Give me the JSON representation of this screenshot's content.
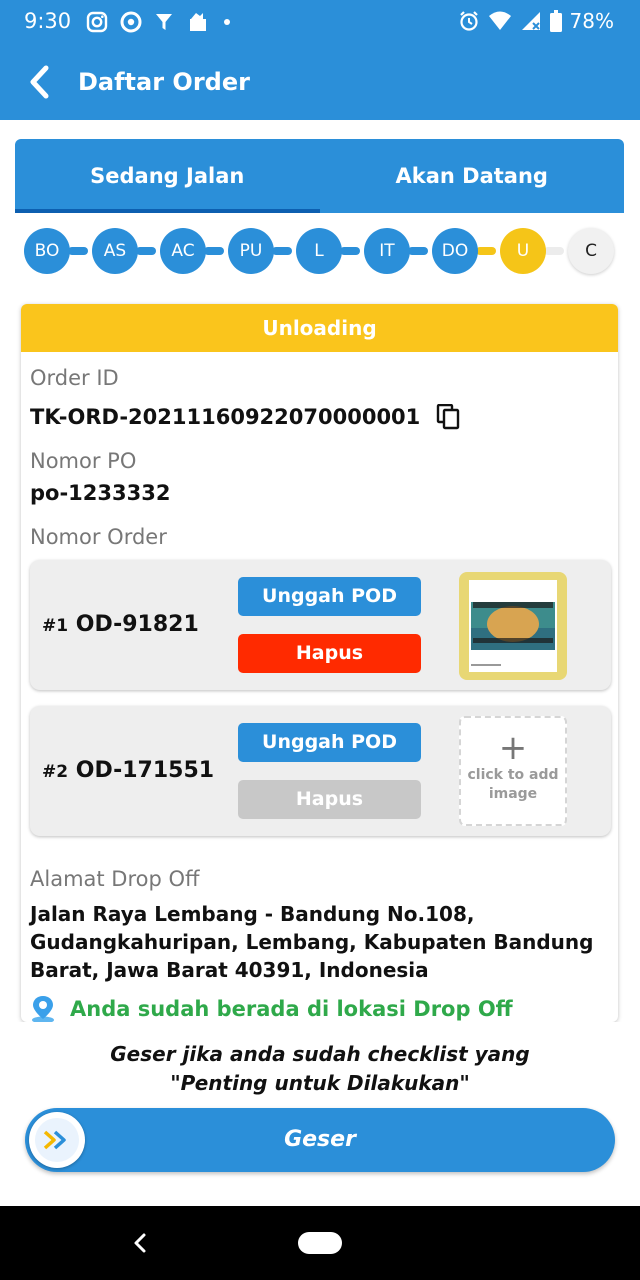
{
  "status_bar": {
    "time": "9:30",
    "battery": "78%",
    "left_icons": [
      "instagram-icon",
      "chrome-icon",
      "filter-icon",
      "bag-icon",
      "dot-icon"
    ],
    "right_icons": [
      "alarm-icon",
      "wifi-icon",
      "signal-icon",
      "battery-icon"
    ]
  },
  "app_bar": {
    "title": "Daftar Order"
  },
  "tabs": [
    {
      "label": "Sedang Jalan",
      "active": true
    },
    {
      "label": "Akan Datang",
      "active": false
    }
  ],
  "steps": [
    {
      "label": "BO",
      "state": "done"
    },
    {
      "label": "AS",
      "state": "done"
    },
    {
      "label": "AC",
      "state": "done"
    },
    {
      "label": "PU",
      "state": "done"
    },
    {
      "label": "L",
      "state": "done"
    },
    {
      "label": "IT",
      "state": "done"
    },
    {
      "label": "DO",
      "state": "done"
    },
    {
      "label": "U",
      "state": "current"
    },
    {
      "label": "C",
      "state": "pending"
    }
  ],
  "card": {
    "header": "Unloading",
    "order_id_label": "Order ID",
    "order_id": "TK-ORD-20211160922070000001",
    "po_label": "Nomor PO",
    "po_value": "po-1233332",
    "order_number_label": "Nomor Order",
    "orders": [
      {
        "index": "#1",
        "code": "OD-91821",
        "upload_label": "Unggah POD",
        "delete_label": "Hapus",
        "delete_enabled": true,
        "has_image": true
      },
      {
        "index": "#2",
        "code": "OD-171551",
        "upload_label": "Unggah POD",
        "delete_label": "Hapus",
        "delete_enabled": false,
        "has_image": false,
        "add_image_plus": "+",
        "add_image_text": "click to add image"
      }
    ],
    "dropoff_label": "Alamat Drop Off",
    "dropoff_address": "Jalan Raya Lembang - Bandung No.108, Gudangkahuripan, Lembang, Kabupaten Bandung Barat, Jawa Barat 40391, Indonesia",
    "location_status": "Anda sudah berada di lokasi Drop Off"
  },
  "bottom": {
    "hint_line1": "Geser jika anda sudah checklist yang",
    "hint_line2": "\"Penting untuk Dilakukan\"",
    "slider_label": "Geser"
  },
  "colors": {
    "primary": "#2b8fd9",
    "header_yellow": "#fac51c",
    "current_step": "#f5c518",
    "delete_red": "#ff2a00",
    "disabled_grey": "#c8c8c8",
    "success_green": "#2fa94a"
  }
}
